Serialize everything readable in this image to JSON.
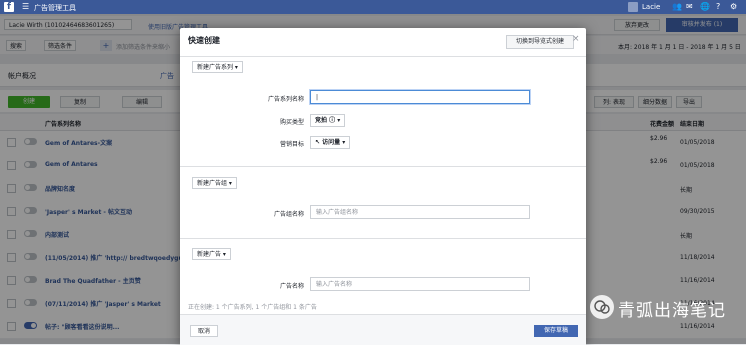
{
  "topbar": {
    "title": "广告管理工具",
    "user": "Lacie"
  },
  "account": {
    "name": "Lacie Wirth (10102464683601265)",
    "link": "使用旧版广告管理工具",
    "discard": "放弃更改",
    "review": "审核并发布 (1)"
  },
  "filters": {
    "search": "搜索",
    "filter": "筛选条件",
    "placeholder": "添加筛选条件来缩小",
    "date_range": "本月: 2018 年 1 月 1 日 - 2018 年 1 月 5 日"
  },
  "tabs": {
    "account_overview": "帐户概况",
    "campaigns": "广告"
  },
  "toolbar": {
    "create": "创建",
    "copy": "复制",
    "edit": "编辑",
    "columns": "列: 表现",
    "breakdown": "细分数据",
    "export": "导出"
  },
  "table": {
    "header_name": "广告系列名称",
    "header_cost": "花费金额",
    "header_end": "结束日期",
    "rows": [
      {
        "name": "Gem of Antares-文案",
        "cost": "$2.96",
        "end": "01/05/2018",
        "on": false
      },
      {
        "name": "Gem of Antares",
        "cost": "$2.96",
        "end": "01/05/2018",
        "on": false
      },
      {
        "name": "品牌知名度",
        "cost": "",
        "end": "长期",
        "on": false
      },
      {
        "name": "'Jasper' s Market - 帖文互动",
        "cost": "",
        "end": "09/30/2015",
        "on": false
      },
      {
        "name": "内部测试",
        "cost": "",
        "end": "长期",
        "on": false
      },
      {
        "name": "(11/05/2014) 推广 'http:// bredtwqoedyguay.",
        "cost": "",
        "end": "11/18/2014",
        "on": false
      },
      {
        "name": "Brad The Quadfather - 主页赞",
        "cost": "",
        "end": "11/16/2014",
        "on": false
      },
      {
        "name": "(07/11/2014) 推广 'Jasper' s Market",
        "cost": "",
        "end": "11/16/2014",
        "on": false
      },
      {
        "name": "帖子: \"顾客看看这份说明...",
        "cost": "",
        "end": "11/16/2014",
        "on": true
      }
    ]
  },
  "modal": {
    "title": "快速创建",
    "switch": "切换到导览式创建",
    "campaign_section": "新建广告系列",
    "campaign_name_label": "广告系列名称",
    "campaign_name_value": "",
    "buy_type_label": "购买类型",
    "buy_type_value": "竞拍",
    "objective_label": "营销目标",
    "objective_value": "访问量",
    "adset_section": "新建广告组",
    "adset_name_label": "广告组名称",
    "adset_name_placeholder": "输入广告组名称",
    "ad_section": "新建广告",
    "ad_name_label": "广告名称",
    "ad_name_placeholder": "输入广告名称",
    "footer_note": "正在创建: 1 个广告系列, 1 个广告组和 1 条广告",
    "cancel": "取消",
    "save": "保存草稿"
  },
  "watermark": {
    "text": "青弧出海笔记"
  }
}
